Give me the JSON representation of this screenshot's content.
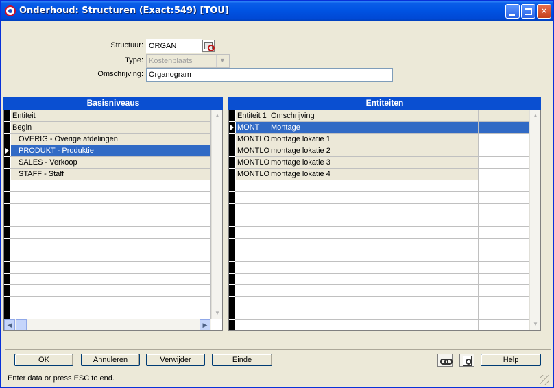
{
  "window": {
    "title": "Onderhoud: Structuren (Exact:549) [TOU]",
    "min_label": "",
    "max_label": "",
    "close_label": "✕"
  },
  "form": {
    "structuur_label": "Structuur:",
    "structuur_value": "ORGAN",
    "type_label": "Type:",
    "type_value": "Kostenplaats",
    "omschrijving_label": "Omschrijving:",
    "omschrijving_value": "Organogram"
  },
  "basis": {
    "title": "Basisniveaus",
    "header": "Entiteit",
    "rows": [
      "Begin",
      "OVERIG - Overige afdelingen",
      "PRODUKT - Produktie",
      "SALES - Verkoop",
      "STAFF - Staff"
    ]
  },
  "entiteiten": {
    "title": "Entiteiten",
    "headers": [
      "Entiteit 1",
      "Omschrijving",
      ""
    ],
    "rows": [
      [
        "MONT",
        "Montage"
      ],
      [
        "MONTLO",
        "montage lokatie 1"
      ],
      [
        "MONTLO",
        "montage lokatie 2"
      ],
      [
        "MONTLO",
        "montage lokatie 3"
      ],
      [
        "MONTLO",
        "montage lokatie 4"
      ]
    ]
  },
  "buttons": {
    "ok": "OK",
    "annuleren": "Annuleren",
    "verwijder": "Verwijder",
    "einde": "Einde",
    "help": "Help"
  },
  "status": "Enter data or press ESC to end."
}
